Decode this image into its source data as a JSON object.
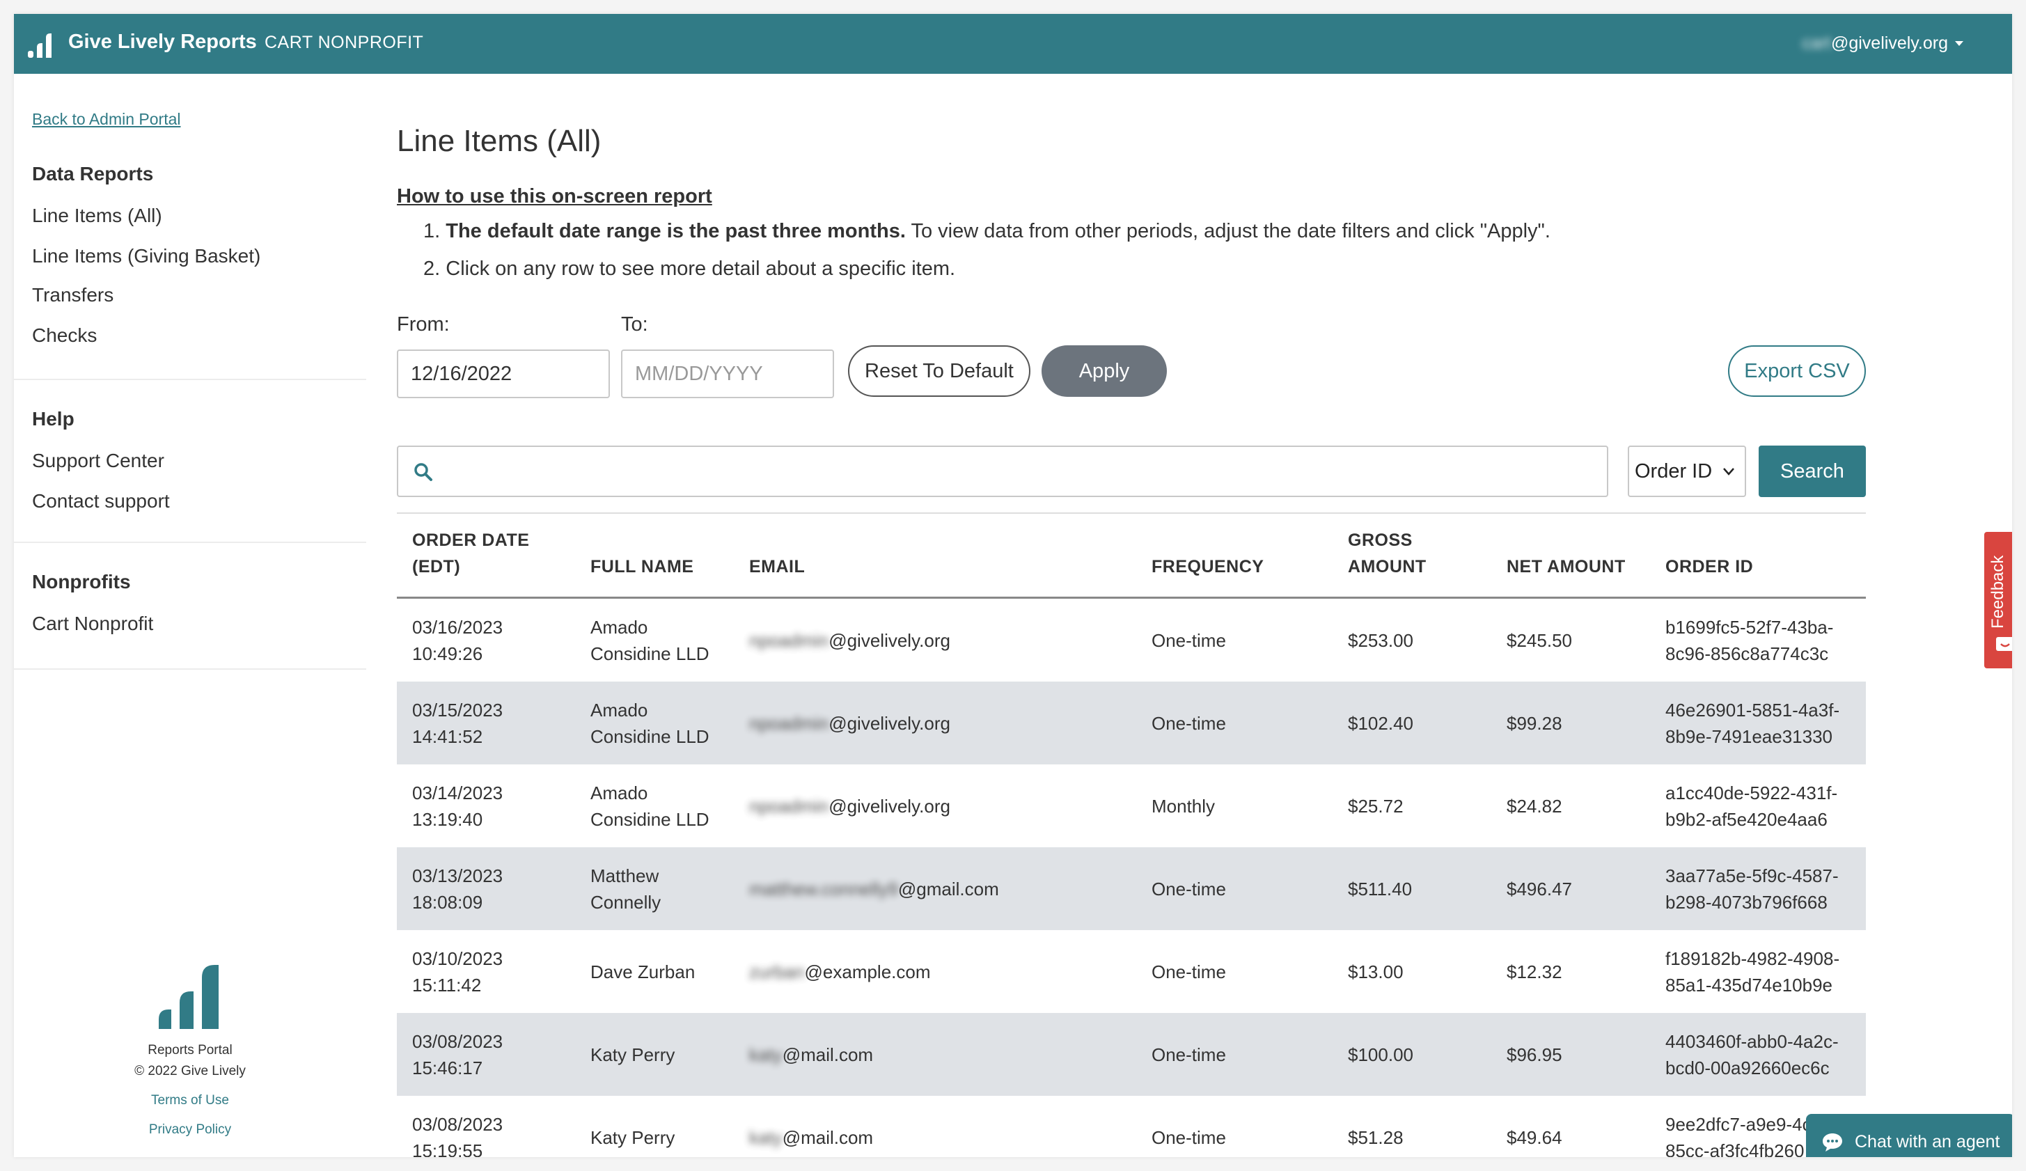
{
  "header": {
    "brand": "Give Lively Reports",
    "org": "CART NONPROFIT",
    "user_hidden": "cart",
    "user_domain": "@givelively.org"
  },
  "sidebar": {
    "back_link": "Back to Admin Portal",
    "data_reports": {
      "heading": "Data Reports",
      "items": [
        "Line Items (All)",
        "Line Items (Giving Basket)",
        "Transfers",
        "Checks"
      ]
    },
    "help": {
      "heading": "Help",
      "items": [
        "Support Center",
        "Contact support"
      ]
    },
    "nonprofits": {
      "heading": "Nonprofits",
      "items": [
        "Cart Nonprofit"
      ]
    },
    "footer": {
      "line1": "Reports Portal",
      "line2": "© 2022 Give Lively",
      "terms": "Terms of Use",
      "privacy": "Privacy Policy"
    }
  },
  "main": {
    "title": "Line Items (All)",
    "howto": "How to use this on-screen report",
    "step1_num": "1.",
    "step1_bold": "The default date range is the past three months.",
    "step1_rest": " To view data from other periods, adjust the date filters and click \"Apply\".",
    "step2_num": "2.",
    "step2": "Click on any row to see more detail about a specific item.",
    "from_label": "From:",
    "to_label": "To:",
    "from_value": "12/16/2022",
    "to_placeholder": "MM/DD/YYYY",
    "reset_label": "Reset To Default",
    "apply_label": "Apply",
    "export_label": "Export CSV",
    "search_placeholder": "",
    "search_field_selected": "Order ID",
    "search_button": "Search"
  },
  "table": {
    "headers": {
      "order_date_1": "ORDER DATE",
      "order_date_2": "(EDT)",
      "full_name": "FULL NAME",
      "email": "EMAIL",
      "frequency": "FREQUENCY",
      "gross_1": "GROSS",
      "gross_2": "AMOUNT",
      "net": "NET AMOUNT",
      "order_id": "ORDER ID"
    },
    "rows": [
      {
        "date": "03/16/2023",
        "time": "10:49:26",
        "name1": "Amado",
        "name2": "Considine LLD",
        "email_hidden": "npoadmin",
        "email_domain": "@givelively.org",
        "frequency": "One-time",
        "gross": "$253.00",
        "net": "$245.50",
        "id1": "b1699fc5-52f7-43ba-",
        "id2": "8c96-856c8a774c3c"
      },
      {
        "date": "03/15/2023",
        "time": "14:41:52",
        "name1": "Amado",
        "name2": "Considine LLD",
        "email_hidden": "npoadmin",
        "email_domain": "@givelively.org",
        "frequency": "One-time",
        "gross": "$102.40",
        "net": "$99.28",
        "id1": "46e26901-5851-4a3f-",
        "id2": "8b9e-7491eae31330"
      },
      {
        "date": "03/14/2023",
        "time": "13:19:40",
        "name1": "Amado",
        "name2": "Considine LLD",
        "email_hidden": "npoadmin",
        "email_domain": "@givelively.org",
        "frequency": "Monthly",
        "gross": "$25.72",
        "net": "$24.82",
        "id1": "a1cc40de-5922-431f-",
        "id2": "b9b2-af5e420e4aa6"
      },
      {
        "date": "03/13/2023",
        "time": "18:08:09",
        "name1": "Matthew",
        "name2": "Connelly",
        "email_hidden": "matthew.connelly9",
        "email_domain": "@gmail.com",
        "frequency": "One-time",
        "gross": "$511.40",
        "net": "$496.47",
        "id1": "3aa77a5e-5f9c-4587-",
        "id2": "b298-4073b796f668"
      },
      {
        "date": "03/10/2023",
        "time": "15:11:42",
        "name1": "Dave Zurban",
        "name2": "",
        "email_hidden": "zurban",
        "email_domain": "@example.com",
        "frequency": "One-time",
        "gross": "$13.00",
        "net": "$12.32",
        "id1": "f189182b-4982-4908-",
        "id2": "85a1-435d74e10b9e"
      },
      {
        "date": "03/08/2023",
        "time": "15:46:17",
        "name1": "Katy Perry",
        "name2": "",
        "email_hidden": "katy",
        "email_domain": "@mail.com",
        "frequency": "One-time",
        "gross": "$100.00",
        "net": "$96.95",
        "id1": "4403460f-abb0-4a2c-",
        "id2": "bcd0-00a92660ec6c"
      },
      {
        "date": "03/08/2023",
        "time": "15:19:55",
        "name1": "Katy Perry",
        "name2": "",
        "email_hidden": "katy",
        "email_domain": "@mail.com",
        "frequency": "One-time",
        "gross": "$51.28",
        "net": "$49.64",
        "id1": "9ee2dfc7-a9e9-4c",
        "id2": "85cc-af3fc4fb260"
      }
    ]
  },
  "widgets": {
    "feedback": "Feedback",
    "chat": "Chat with an agent"
  },
  "colors": {
    "brand_teal": "#317b86",
    "apply_gray": "#6c747d",
    "row_alt": "#dfe2e6",
    "feedback_red": "#d9453f"
  }
}
